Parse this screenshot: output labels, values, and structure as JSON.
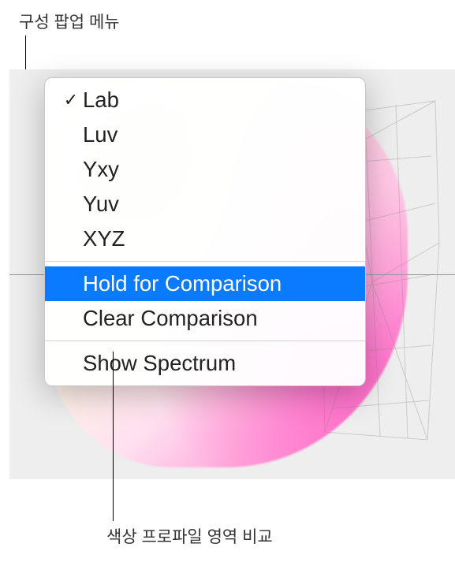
{
  "annotations": {
    "top": "구성 팝업 메뉴",
    "bottom": "색상 프로파일 영역 비교"
  },
  "menu": {
    "items": [
      {
        "label": "Lab",
        "checked": true,
        "highlighted": false
      },
      {
        "label": "Luv",
        "checked": false,
        "highlighted": false
      },
      {
        "label": "Yxy",
        "checked": false,
        "highlighted": false
      },
      {
        "label": "Yuv",
        "checked": false,
        "highlighted": false
      },
      {
        "label": "XYZ",
        "checked": false,
        "highlighted": false
      }
    ],
    "group2": [
      {
        "label": "Hold for Comparison",
        "checked": false,
        "highlighted": true
      },
      {
        "label": "Clear Comparison",
        "checked": false,
        "highlighted": false
      }
    ],
    "group3": [
      {
        "label": "Show Spectrum",
        "checked": false,
        "highlighted": false
      }
    ]
  },
  "icons": {
    "check": "✓"
  }
}
